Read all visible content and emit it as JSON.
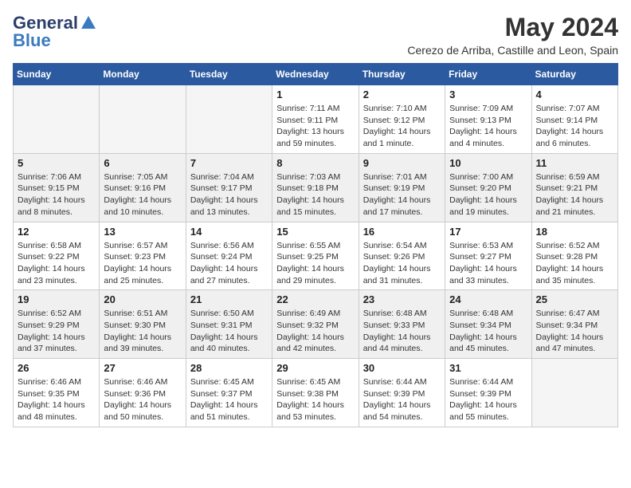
{
  "logo": {
    "general": "General",
    "blue": "Blue"
  },
  "title": "May 2024",
  "location": "Cerezo de Arriba, Castille and Leon, Spain",
  "days_header": [
    "Sunday",
    "Monday",
    "Tuesday",
    "Wednesday",
    "Thursday",
    "Friday",
    "Saturday"
  ],
  "weeks": [
    [
      {
        "day": "",
        "sunrise": "",
        "sunset": "",
        "daylight": ""
      },
      {
        "day": "",
        "sunrise": "",
        "sunset": "",
        "daylight": ""
      },
      {
        "day": "",
        "sunrise": "",
        "sunset": "",
        "daylight": ""
      },
      {
        "day": "1",
        "sunrise": "Sunrise: 7:11 AM",
        "sunset": "Sunset: 9:11 PM",
        "daylight": "Daylight: 13 hours and 59 minutes."
      },
      {
        "day": "2",
        "sunrise": "Sunrise: 7:10 AM",
        "sunset": "Sunset: 9:12 PM",
        "daylight": "Daylight: 14 hours and 1 minute."
      },
      {
        "day": "3",
        "sunrise": "Sunrise: 7:09 AM",
        "sunset": "Sunset: 9:13 PM",
        "daylight": "Daylight: 14 hours and 4 minutes."
      },
      {
        "day": "4",
        "sunrise": "Sunrise: 7:07 AM",
        "sunset": "Sunset: 9:14 PM",
        "daylight": "Daylight: 14 hours and 6 minutes."
      }
    ],
    [
      {
        "day": "5",
        "sunrise": "Sunrise: 7:06 AM",
        "sunset": "Sunset: 9:15 PM",
        "daylight": "Daylight: 14 hours and 8 minutes."
      },
      {
        "day": "6",
        "sunrise": "Sunrise: 7:05 AM",
        "sunset": "Sunset: 9:16 PM",
        "daylight": "Daylight: 14 hours and 10 minutes."
      },
      {
        "day": "7",
        "sunrise": "Sunrise: 7:04 AM",
        "sunset": "Sunset: 9:17 PM",
        "daylight": "Daylight: 14 hours and 13 minutes."
      },
      {
        "day": "8",
        "sunrise": "Sunrise: 7:03 AM",
        "sunset": "Sunset: 9:18 PM",
        "daylight": "Daylight: 14 hours and 15 minutes."
      },
      {
        "day": "9",
        "sunrise": "Sunrise: 7:01 AM",
        "sunset": "Sunset: 9:19 PM",
        "daylight": "Daylight: 14 hours and 17 minutes."
      },
      {
        "day": "10",
        "sunrise": "Sunrise: 7:00 AM",
        "sunset": "Sunset: 9:20 PM",
        "daylight": "Daylight: 14 hours and 19 minutes."
      },
      {
        "day": "11",
        "sunrise": "Sunrise: 6:59 AM",
        "sunset": "Sunset: 9:21 PM",
        "daylight": "Daylight: 14 hours and 21 minutes."
      }
    ],
    [
      {
        "day": "12",
        "sunrise": "Sunrise: 6:58 AM",
        "sunset": "Sunset: 9:22 PM",
        "daylight": "Daylight: 14 hours and 23 minutes."
      },
      {
        "day": "13",
        "sunrise": "Sunrise: 6:57 AM",
        "sunset": "Sunset: 9:23 PM",
        "daylight": "Daylight: 14 hours and 25 minutes."
      },
      {
        "day": "14",
        "sunrise": "Sunrise: 6:56 AM",
        "sunset": "Sunset: 9:24 PM",
        "daylight": "Daylight: 14 hours and 27 minutes."
      },
      {
        "day": "15",
        "sunrise": "Sunrise: 6:55 AM",
        "sunset": "Sunset: 9:25 PM",
        "daylight": "Daylight: 14 hours and 29 minutes."
      },
      {
        "day": "16",
        "sunrise": "Sunrise: 6:54 AM",
        "sunset": "Sunset: 9:26 PM",
        "daylight": "Daylight: 14 hours and 31 minutes."
      },
      {
        "day": "17",
        "sunrise": "Sunrise: 6:53 AM",
        "sunset": "Sunset: 9:27 PM",
        "daylight": "Daylight: 14 hours and 33 minutes."
      },
      {
        "day": "18",
        "sunrise": "Sunrise: 6:52 AM",
        "sunset": "Sunset: 9:28 PM",
        "daylight": "Daylight: 14 hours and 35 minutes."
      }
    ],
    [
      {
        "day": "19",
        "sunrise": "Sunrise: 6:52 AM",
        "sunset": "Sunset: 9:29 PM",
        "daylight": "Daylight: 14 hours and 37 minutes."
      },
      {
        "day": "20",
        "sunrise": "Sunrise: 6:51 AM",
        "sunset": "Sunset: 9:30 PM",
        "daylight": "Daylight: 14 hours and 39 minutes."
      },
      {
        "day": "21",
        "sunrise": "Sunrise: 6:50 AM",
        "sunset": "Sunset: 9:31 PM",
        "daylight": "Daylight: 14 hours and 40 minutes."
      },
      {
        "day": "22",
        "sunrise": "Sunrise: 6:49 AM",
        "sunset": "Sunset: 9:32 PM",
        "daylight": "Daylight: 14 hours and 42 minutes."
      },
      {
        "day": "23",
        "sunrise": "Sunrise: 6:48 AM",
        "sunset": "Sunset: 9:33 PM",
        "daylight": "Daylight: 14 hours and 44 minutes."
      },
      {
        "day": "24",
        "sunrise": "Sunrise: 6:48 AM",
        "sunset": "Sunset: 9:34 PM",
        "daylight": "Daylight: 14 hours and 45 minutes."
      },
      {
        "day": "25",
        "sunrise": "Sunrise: 6:47 AM",
        "sunset": "Sunset: 9:34 PM",
        "daylight": "Daylight: 14 hours and 47 minutes."
      }
    ],
    [
      {
        "day": "26",
        "sunrise": "Sunrise: 6:46 AM",
        "sunset": "Sunset: 9:35 PM",
        "daylight": "Daylight: 14 hours and 48 minutes."
      },
      {
        "day": "27",
        "sunrise": "Sunrise: 6:46 AM",
        "sunset": "Sunset: 9:36 PM",
        "daylight": "Daylight: 14 hours and 50 minutes."
      },
      {
        "day": "28",
        "sunrise": "Sunrise: 6:45 AM",
        "sunset": "Sunset: 9:37 PM",
        "daylight": "Daylight: 14 hours and 51 minutes."
      },
      {
        "day": "29",
        "sunrise": "Sunrise: 6:45 AM",
        "sunset": "Sunset: 9:38 PM",
        "daylight": "Daylight: 14 hours and 53 minutes."
      },
      {
        "day": "30",
        "sunrise": "Sunrise: 6:44 AM",
        "sunset": "Sunset: 9:39 PM",
        "daylight": "Daylight: 14 hours and 54 minutes."
      },
      {
        "day": "31",
        "sunrise": "Sunrise: 6:44 AM",
        "sunset": "Sunset: 9:39 PM",
        "daylight": "Daylight: 14 hours and 55 minutes."
      },
      {
        "day": "",
        "sunrise": "",
        "sunset": "",
        "daylight": ""
      }
    ]
  ]
}
